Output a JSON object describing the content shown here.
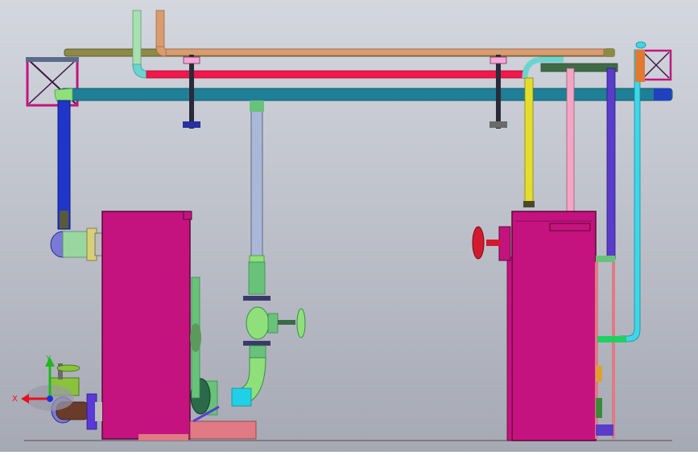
{
  "viewport": {
    "background_top": "#d4d7df",
    "background_bottom": "#a6a9b4"
  },
  "triad": {
    "x_label": "X",
    "y_label": "Y",
    "x_color": "#e8101c",
    "y_color": "#1fb81f",
    "z_color": "#2030e0"
  },
  "colors": {
    "magenta": "#c4137e",
    "frame_dark": "#3a1a40",
    "pipe_teal": "#1e7f96",
    "pipe_red": "#f0174a",
    "pipe_olive": "#8c8a45",
    "pipe_copper": "#d99c6e",
    "pipe_green": "#3e6b46",
    "pipe_yellow": "#e3de2c",
    "pipe_pink": "#f2a6c4",
    "pipe_purple": "#5a3cc9",
    "pipe_cyan": "#3fd6e8",
    "pipe_blue": "#2036c9",
    "pipe_steel": "#a9b8d6",
    "pump_green": "#68c27a",
    "valve_red": "#d11a2e",
    "salmon": "#e07a84"
  }
}
